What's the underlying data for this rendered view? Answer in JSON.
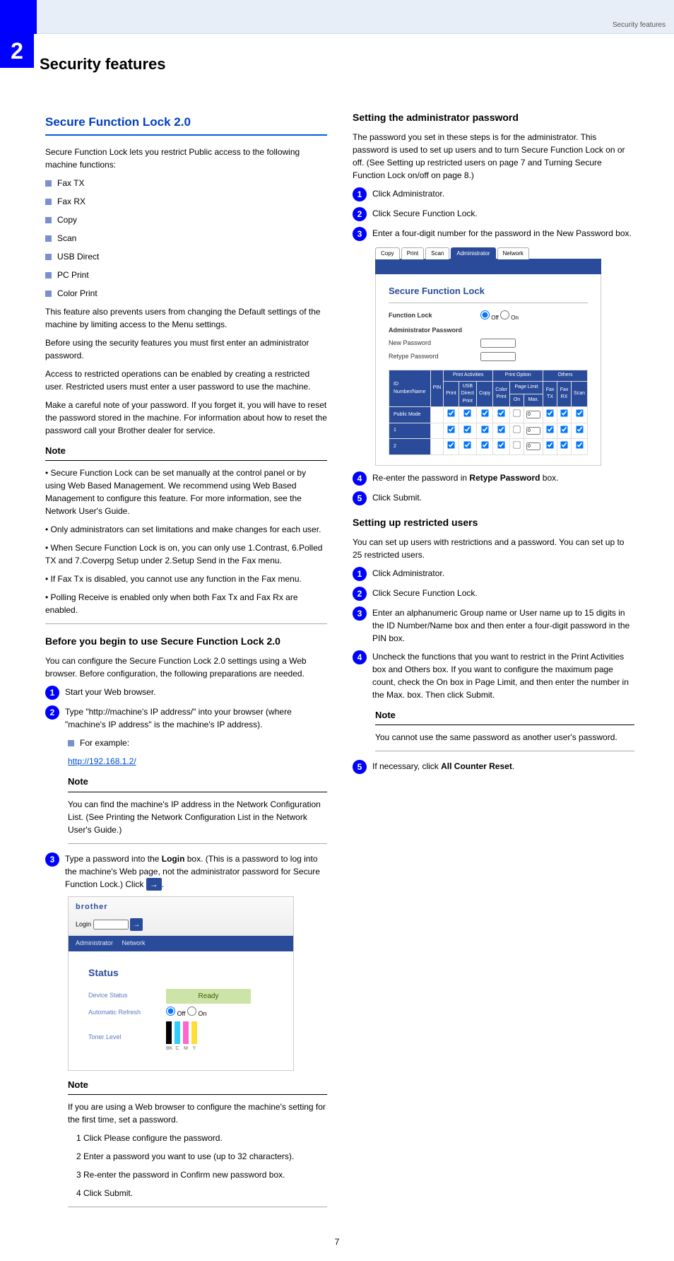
{
  "header": {
    "tab_label": "2",
    "right_text": "Security features"
  },
  "page_title": "Security features",
  "left": {
    "section_title": "Secure Function Lock 2.0",
    "intro_p1": "Secure Function Lock lets you restrict Public access to the following machine functions:",
    "func_list": [
      "Fax TX",
      "Fax RX",
      "Copy",
      "Scan",
      "USB Direct",
      "PC Print",
      "Color Print"
    ],
    "intro_p2": "This feature also prevents users from changing the Default settings of the machine by limiting access to the Menu settings.",
    "intro_p3": "Before using the security features you must first enter an administrator password.",
    "intro_p4": "Access to restricted operations can be enabled by creating a restricted user. Restricted users must enter a user password to use the machine.",
    "intro_p5_a": "Make a careful note of your password. If you forget it, you will have to reset the password stored in the machine. For information about how to reset the password call your Brother dealer for service.",
    "note1_title": "Note",
    "note1_items": [
      "Secure Function Lock can be set manually at the control panel or by using Web Based Management. We recommend using Web Based Management to configure this feature. For more information, see the Network User's Guide.",
      "Only administrators can set limitations and make changes for each user.",
      "When Secure Function Lock is on, you can only use 1.Contrast, 6.Polled TX and 7.Coverpg Setup under 2.Setup Send in the Fax menu.",
      "If Fax Tx is disabled, you cannot use any function in the Fax menu.",
      "Polling Receive is enabled only when both Fax Tx and Fax Rx are enabled."
    ]
  },
  "right": {
    "sub1_title": "Before you begin to use Secure Function Lock 2.0",
    "sub1_intro": "You can configure the Secure Function Lock 2.0 settings using a Web browser. Before configuration, the following preparations are needed.",
    "sub1_steps": [
      "Start your Web browser.",
      "Type \"http://machine's IP address/\" into your browser (where \"machine's IP address\" is the machine's IP address).",
      ""
    ],
    "example_label": "For example:",
    "example_url": "http://192.168.1.2/",
    "note2_title": "Note",
    "note2_body": "You can find the machine's IP address in the Network Configuration List. (See Printing the Network Configuration List in the Network User's Guide.)",
    "step3_a": "Type a password into the ",
    "step3_login": "Login",
    "step3_b": " box. (This is a password to log into the machine's Web page, not the administrator password for Secure Function Lock.) Click ",
    "arrow_icon": "→",
    "wbm": {
      "brand": "brother",
      "login_label": "Login",
      "nav1": "Administrator",
      "nav2": "Network",
      "status_title": "Status",
      "row1": "Device Status",
      "row1_val": "Ready",
      "row2": "Automatic Refresh",
      "row2_off": "Off",
      "row2_on": "On",
      "row3": "Toner Level",
      "toner_bk": "BK",
      "toner_c": "C",
      "toner_m": "M",
      "toner_y": "Y"
    },
    "note3_title": "Note",
    "note3_body_a": "If you are using a Web browser to configure the machine's setting for the first time, set a password.",
    "note3_items": [
      "Click Please configure the password.",
      "Enter a password you want to use (up to 32 characters).",
      "Re-enter the password in Confirm new password box.",
      "Click Submit."
    ],
    "sub2_title": "Setting the administrator password",
    "sub2_intro": "The password you set in these steps is for the administrator. This password is used to set up users and to turn Secure Function Lock on or off. (See Setting up restricted users on page 7 and Turning Secure Function Lock on/off on page 8.)",
    "sub2_steps": [
      "Click Administrator.",
      "Click Secure Function Lock.",
      "Enter a four-digit number for the password in the New Password box."
    ],
    "sfl": {
      "tabs": [
        "Copy",
        "Print",
        "Scan",
        "Administrator",
        "Network"
      ],
      "title": "Secure Function Lock",
      "fl_label": "Function Lock",
      "off": "Off",
      "on": "On",
      "ap_label": "Administrator Password",
      "np_label": "New Password",
      "rp_label": "Retype Password",
      "th_idname": "ID Number/Name",
      "th_pin": "PIN",
      "th_pa": "Print Activities",
      "th_po": "Print Option",
      "th_other": "Others",
      "th_print": "Print",
      "th_usb": "USB Direct Print",
      "th_copy": "Copy",
      "th_color": "Color Print",
      "th_pl": "Page Limit",
      "th_plon": "On",
      "th_plmax": "Max.",
      "th_faxtx": "Fax TX",
      "th_faxrx": "Fax RX",
      "th_scan": "Scan",
      "row_public": "Public Mode"
    },
    "step4_a": "Re-enter the password in ",
    "step4_b": "Retype Password",
    "step4_c": " box.",
    "step5": "Click Submit.",
    "sub3_title": "Setting up restricted users",
    "sub3_intro": "You can set up users with restrictions and a password. You can set up to 25 restricted users.",
    "sub3_steps": [
      "Click Administrator.",
      "Click Secure Function Lock.",
      "Enter an alphanumeric Group name or User name up to 15 digits in the ID Number/Name box and then enter a four-digit password in the PIN box.",
      "Uncheck the functions that you want to restrict in the Print Activities box and Others box. If you want to configure the maximum page count, check the On box in Page Limit, and then enter the number in the Max. box. Then click Submit.",
      ""
    ],
    "note4_title": "Note",
    "note4_body": "You cannot use the same password as another user's password.",
    "step5b_a": "If necessary, click ",
    "step5b_b": "All Counter Reset",
    "step5b_c": "."
  },
  "page_num": "7"
}
